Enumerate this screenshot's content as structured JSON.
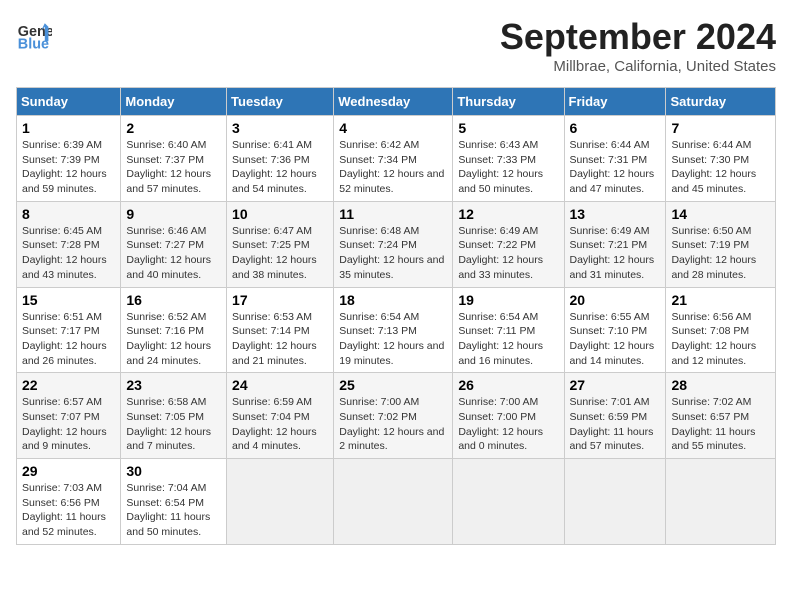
{
  "header": {
    "logo_line1": "General",
    "logo_line2": "Blue",
    "title": "September 2024",
    "subtitle": "Millbrae, California, United States"
  },
  "columns": [
    "Sunday",
    "Monday",
    "Tuesday",
    "Wednesday",
    "Thursday",
    "Friday",
    "Saturday"
  ],
  "weeks": [
    [
      {
        "day": "1",
        "sunrise": "6:39 AM",
        "sunset": "7:39 PM",
        "daylight": "12 hours and 59 minutes."
      },
      {
        "day": "2",
        "sunrise": "6:40 AM",
        "sunset": "7:37 PM",
        "daylight": "12 hours and 57 minutes."
      },
      {
        "day": "3",
        "sunrise": "6:41 AM",
        "sunset": "7:36 PM",
        "daylight": "12 hours and 54 minutes."
      },
      {
        "day": "4",
        "sunrise": "6:42 AM",
        "sunset": "7:34 PM",
        "daylight": "12 hours and 52 minutes."
      },
      {
        "day": "5",
        "sunrise": "6:43 AM",
        "sunset": "7:33 PM",
        "daylight": "12 hours and 50 minutes."
      },
      {
        "day": "6",
        "sunrise": "6:44 AM",
        "sunset": "7:31 PM",
        "daylight": "12 hours and 47 minutes."
      },
      {
        "day": "7",
        "sunrise": "6:44 AM",
        "sunset": "7:30 PM",
        "daylight": "12 hours and 45 minutes."
      }
    ],
    [
      {
        "day": "8",
        "sunrise": "6:45 AM",
        "sunset": "7:28 PM",
        "daylight": "12 hours and 43 minutes."
      },
      {
        "day": "9",
        "sunrise": "6:46 AM",
        "sunset": "7:27 PM",
        "daylight": "12 hours and 40 minutes."
      },
      {
        "day": "10",
        "sunrise": "6:47 AM",
        "sunset": "7:25 PM",
        "daylight": "12 hours and 38 minutes."
      },
      {
        "day": "11",
        "sunrise": "6:48 AM",
        "sunset": "7:24 PM",
        "daylight": "12 hours and 35 minutes."
      },
      {
        "day": "12",
        "sunrise": "6:49 AM",
        "sunset": "7:22 PM",
        "daylight": "12 hours and 33 minutes."
      },
      {
        "day": "13",
        "sunrise": "6:49 AM",
        "sunset": "7:21 PM",
        "daylight": "12 hours and 31 minutes."
      },
      {
        "day": "14",
        "sunrise": "6:50 AM",
        "sunset": "7:19 PM",
        "daylight": "12 hours and 28 minutes."
      }
    ],
    [
      {
        "day": "15",
        "sunrise": "6:51 AM",
        "sunset": "7:17 PM",
        "daylight": "12 hours and 26 minutes."
      },
      {
        "day": "16",
        "sunrise": "6:52 AM",
        "sunset": "7:16 PM",
        "daylight": "12 hours and 24 minutes."
      },
      {
        "day": "17",
        "sunrise": "6:53 AM",
        "sunset": "7:14 PM",
        "daylight": "12 hours and 21 minutes."
      },
      {
        "day": "18",
        "sunrise": "6:54 AM",
        "sunset": "7:13 PM",
        "daylight": "12 hours and 19 minutes."
      },
      {
        "day": "19",
        "sunrise": "6:54 AM",
        "sunset": "7:11 PM",
        "daylight": "12 hours and 16 minutes."
      },
      {
        "day": "20",
        "sunrise": "6:55 AM",
        "sunset": "7:10 PM",
        "daylight": "12 hours and 14 minutes."
      },
      {
        "day": "21",
        "sunrise": "6:56 AM",
        "sunset": "7:08 PM",
        "daylight": "12 hours and 12 minutes."
      }
    ],
    [
      {
        "day": "22",
        "sunrise": "6:57 AM",
        "sunset": "7:07 PM",
        "daylight": "12 hours and 9 minutes."
      },
      {
        "day": "23",
        "sunrise": "6:58 AM",
        "sunset": "7:05 PM",
        "daylight": "12 hours and 7 minutes."
      },
      {
        "day": "24",
        "sunrise": "6:59 AM",
        "sunset": "7:04 PM",
        "daylight": "12 hours and 4 minutes."
      },
      {
        "day": "25",
        "sunrise": "7:00 AM",
        "sunset": "7:02 PM",
        "daylight": "12 hours and 2 minutes."
      },
      {
        "day": "26",
        "sunrise": "7:00 AM",
        "sunset": "7:00 PM",
        "daylight": "12 hours and 0 minutes."
      },
      {
        "day": "27",
        "sunrise": "7:01 AM",
        "sunset": "6:59 PM",
        "daylight": "11 hours and 57 minutes."
      },
      {
        "day": "28",
        "sunrise": "7:02 AM",
        "sunset": "6:57 PM",
        "daylight": "11 hours and 55 minutes."
      }
    ],
    [
      {
        "day": "29",
        "sunrise": "7:03 AM",
        "sunset": "6:56 PM",
        "daylight": "11 hours and 52 minutes."
      },
      {
        "day": "30",
        "sunrise": "7:04 AM",
        "sunset": "6:54 PM",
        "daylight": "11 hours and 50 minutes."
      },
      null,
      null,
      null,
      null,
      null
    ]
  ]
}
